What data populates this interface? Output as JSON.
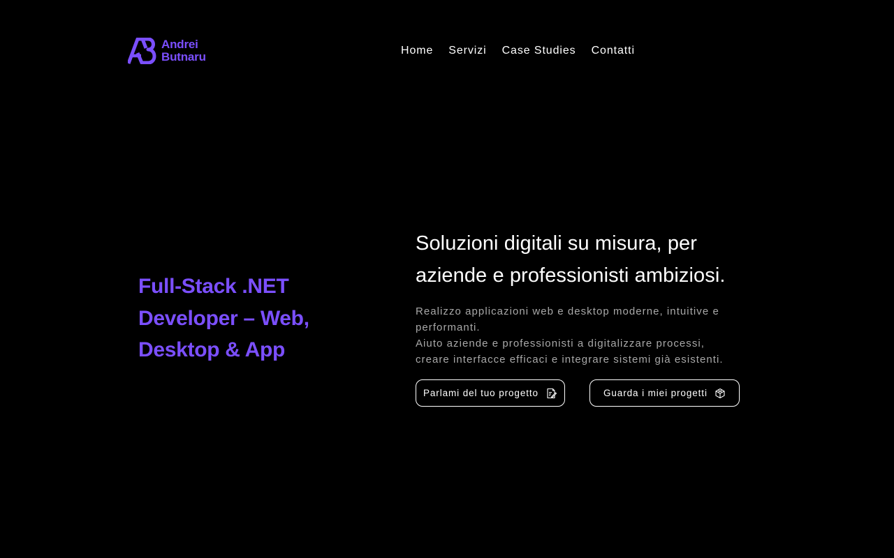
{
  "brand": {
    "first_name": "Andrei",
    "last_name": "Butnaru",
    "accent_color": "#7b4fff",
    "logo_icon": "ab-monogram-icon"
  },
  "nav": {
    "items": [
      {
        "label": "Home"
      },
      {
        "label": "Servizi"
      },
      {
        "label": "Case Studies"
      },
      {
        "label": "Contatti"
      }
    ]
  },
  "hero": {
    "tagline_lines": [
      "Full-Stack .NET",
      "Developer – Web,",
      "Desktop & App"
    ],
    "headline_lines": [
      "Soluzioni digitali su misura, per",
      "aziende e professionisti ambiziosi."
    ],
    "description_lines": [
      "Realizzo applicazioni web e desktop moderne, intuitive e",
      "performanti.",
      "Aiuto aziende e professionisti a digitalizzare processi,",
      "creare interfacce efficaci e integrare sistemi già esistenti."
    ],
    "primary_button": {
      "label": "Parlami del tuo progetto",
      "icon": "edit-document-icon"
    },
    "secondary_button": {
      "label": "Guarda i miei progetti",
      "icon": "cube-icon"
    }
  },
  "colors": {
    "background": "#000000",
    "text": "#ffffff",
    "muted_text": "#a8a8a8"
  }
}
